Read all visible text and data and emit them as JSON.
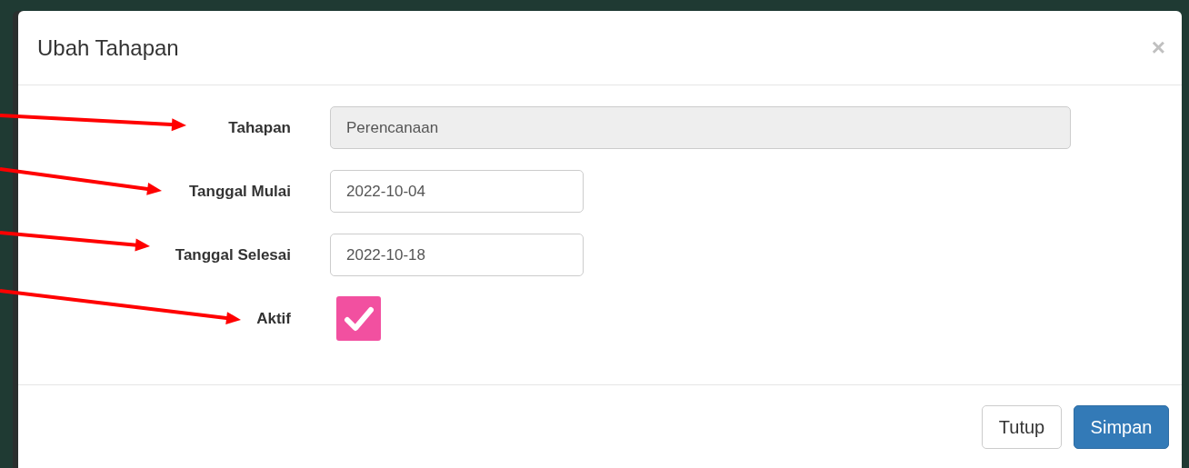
{
  "dialog": {
    "title": "Ubah Tahapan",
    "close": "×"
  },
  "fields": [
    {
      "kind": "readonly",
      "label": "Tahapan",
      "value": "Perencanaan",
      "arrow": true
    },
    {
      "kind": "input",
      "label": "Tanggal Mulai",
      "value": "2022-10-04",
      "arrow": true
    },
    {
      "kind": "input",
      "label": "Tanggal Selesai",
      "value": "2022-10-18",
      "arrow": true
    },
    {
      "kind": "checkbox",
      "label": "Aktif",
      "checked": true,
      "arrow": true
    }
  ],
  "buttons": [
    {
      "label": "Tutup",
      "kind": "default"
    },
    {
      "label": "Simpan",
      "kind": "primary"
    }
  ]
}
